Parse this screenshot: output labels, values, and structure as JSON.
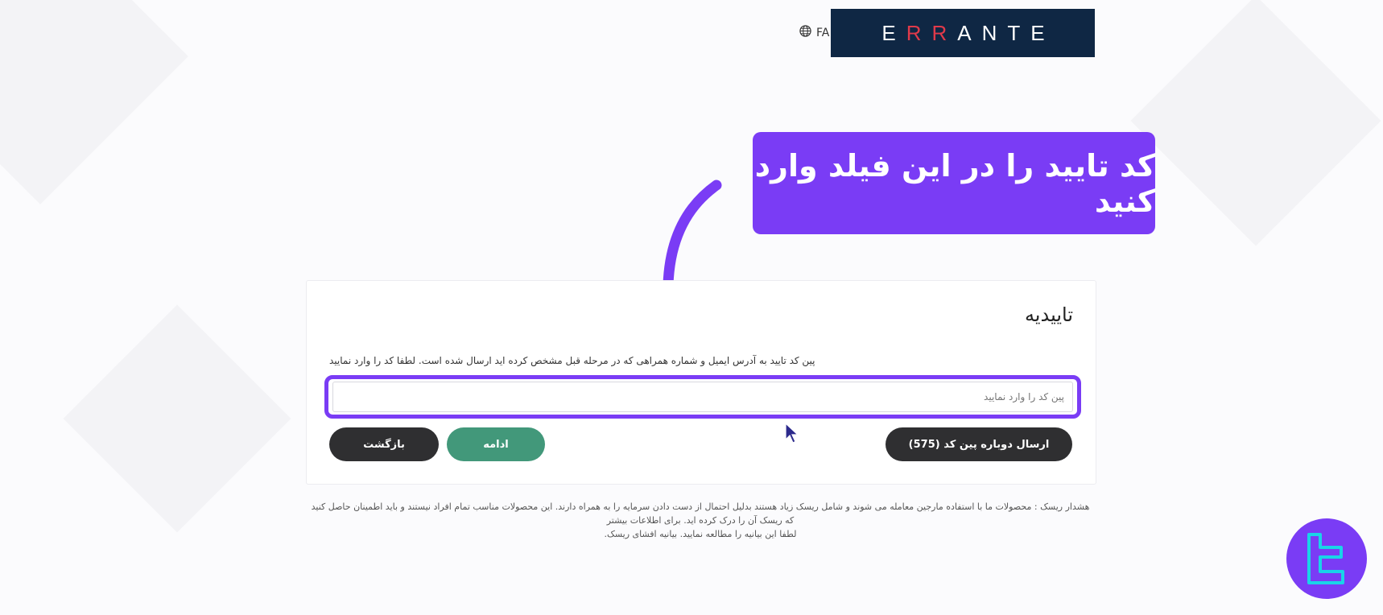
{
  "header": {
    "language": "FA",
    "brand": {
      "left": "E",
      "middle": "RR",
      "right": "ANTE"
    }
  },
  "callout": {
    "text": "کد تایید را در این فیلد وارد کنید",
    "color": "#7a3cf5"
  },
  "card": {
    "title": "تاییدیه",
    "description": "پین کد تایید به آدرس ایمیل و شماره همراهی که در مرحله قبل مشخص کرده اید ارسال شده است. لطفا کد را وارد نمایید",
    "pin_input": {
      "value": "",
      "placeholder": "پین کد را وارد نمایید"
    },
    "buttons": {
      "resend": "ارسال دوباره پین کد (575)",
      "continue": "ادامه",
      "back": "بازگشت"
    }
  },
  "risk_warning": {
    "line1": "هشدار ریسک : محصولات ما با استفاده مارجین معامله می شوند و شامل ریسک زیاد هستند بدلیل احتمال از دست دادن سرمایه را به همراه دارند. این محصولات مناسب تمام افراد نیستند و باید اطمینان حاصل کنید که ریسک آن را درک کرده اید. برای اطلاعات بیشتر",
    "line2": "لطفا این بیانیه را مطالعه نمایید. بیانیه افشای ریسک."
  },
  "colors": {
    "accent": "#7a3cf5",
    "brand_bg": "#0f2744",
    "brand_accent": "#e03a4a",
    "continue_button": "#42987a",
    "dark_button": "#2f2f31"
  }
}
